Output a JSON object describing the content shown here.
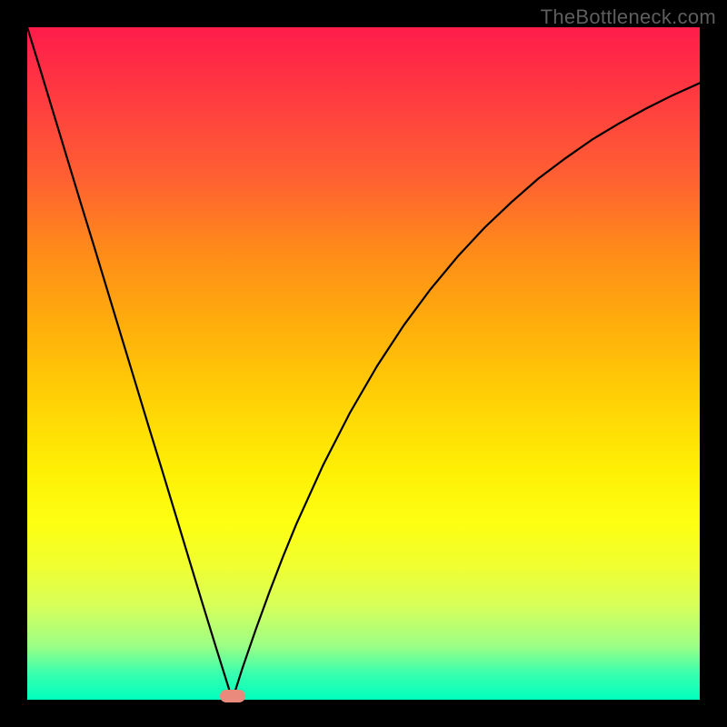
{
  "watermark": "TheBottleneck.com",
  "chart_data": {
    "type": "line",
    "title": "",
    "xlabel": "",
    "ylabel": "",
    "xlim": [
      0,
      1
    ],
    "ylim": [
      0,
      1
    ],
    "x": [
      0.0,
      0.02,
      0.04,
      0.06,
      0.08,
      0.1,
      0.12,
      0.14,
      0.16,
      0.18,
      0.2,
      0.22,
      0.24,
      0.26,
      0.28,
      0.3,
      0.305,
      0.32,
      0.34,
      0.36,
      0.38,
      0.4,
      0.44,
      0.48,
      0.52,
      0.56,
      0.6,
      0.64,
      0.68,
      0.72,
      0.76,
      0.8,
      0.84,
      0.88,
      0.92,
      0.96,
      1.0
    ],
    "values": [
      1.0,
      0.935,
      0.869,
      0.803,
      0.737,
      0.672,
      0.606,
      0.54,
      0.474,
      0.408,
      0.343,
      0.277,
      0.211,
      0.145,
      0.08,
      0.016,
      0.0,
      0.047,
      0.105,
      0.16,
      0.212,
      0.261,
      0.349,
      0.427,
      0.496,
      0.557,
      0.611,
      0.659,
      0.702,
      0.74,
      0.775,
      0.805,
      0.833,
      0.857,
      0.879,
      0.899,
      0.917
    ],
    "marker": {
      "x": 0.305,
      "y": 0.0
    },
    "background_gradient_top": "#ff1c4b",
    "background_gradient_mid": "#ffd005",
    "background_gradient_bottom": "#00ffbd"
  }
}
